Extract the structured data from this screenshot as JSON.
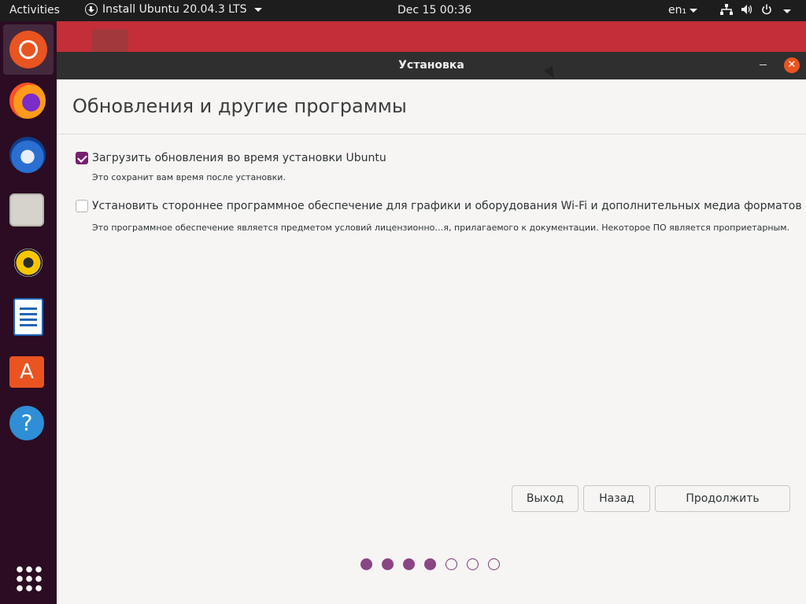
{
  "topbar": {
    "activities": "Activities",
    "app_menu": "Install Ubuntu 20.04.3 LTS",
    "clock": "Dec 15  00:36",
    "language": "en₁"
  },
  "dock": {
    "items": [
      "ubuntu-installer",
      "firefox",
      "thunderbird",
      "files",
      "rhythmbox",
      "libreoffice-writer",
      "ubuntu-software",
      "help",
      "show-applications"
    ]
  },
  "window": {
    "title": "Установка",
    "heading": "Обновления и другие программы",
    "options": [
      {
        "label": "Загрузить обновления во время установки Ubuntu",
        "description": "Это сохранит вам время после установки.",
        "checked": true
      },
      {
        "label": "Установить стороннее программное обеспечение для графики и оборудования Wi-Fi и дополнительных медиа форматов",
        "description": "Это программное обеспечение является предметом условий лицензионно…я, прилагаемого к документации. Некоторое ПО является проприетарным.",
        "checked": false
      }
    ],
    "buttons": {
      "quit": "Выход",
      "back": "Назад",
      "continue": "Продолжить"
    },
    "progress": {
      "current_step": 4,
      "total_steps": 7
    }
  },
  "colors": {
    "accent": "#e95420",
    "checkbox": "#77216f",
    "progress_dot": "#8a4584",
    "dock": "#2b0c22",
    "topbar": "#1d1d1d"
  }
}
